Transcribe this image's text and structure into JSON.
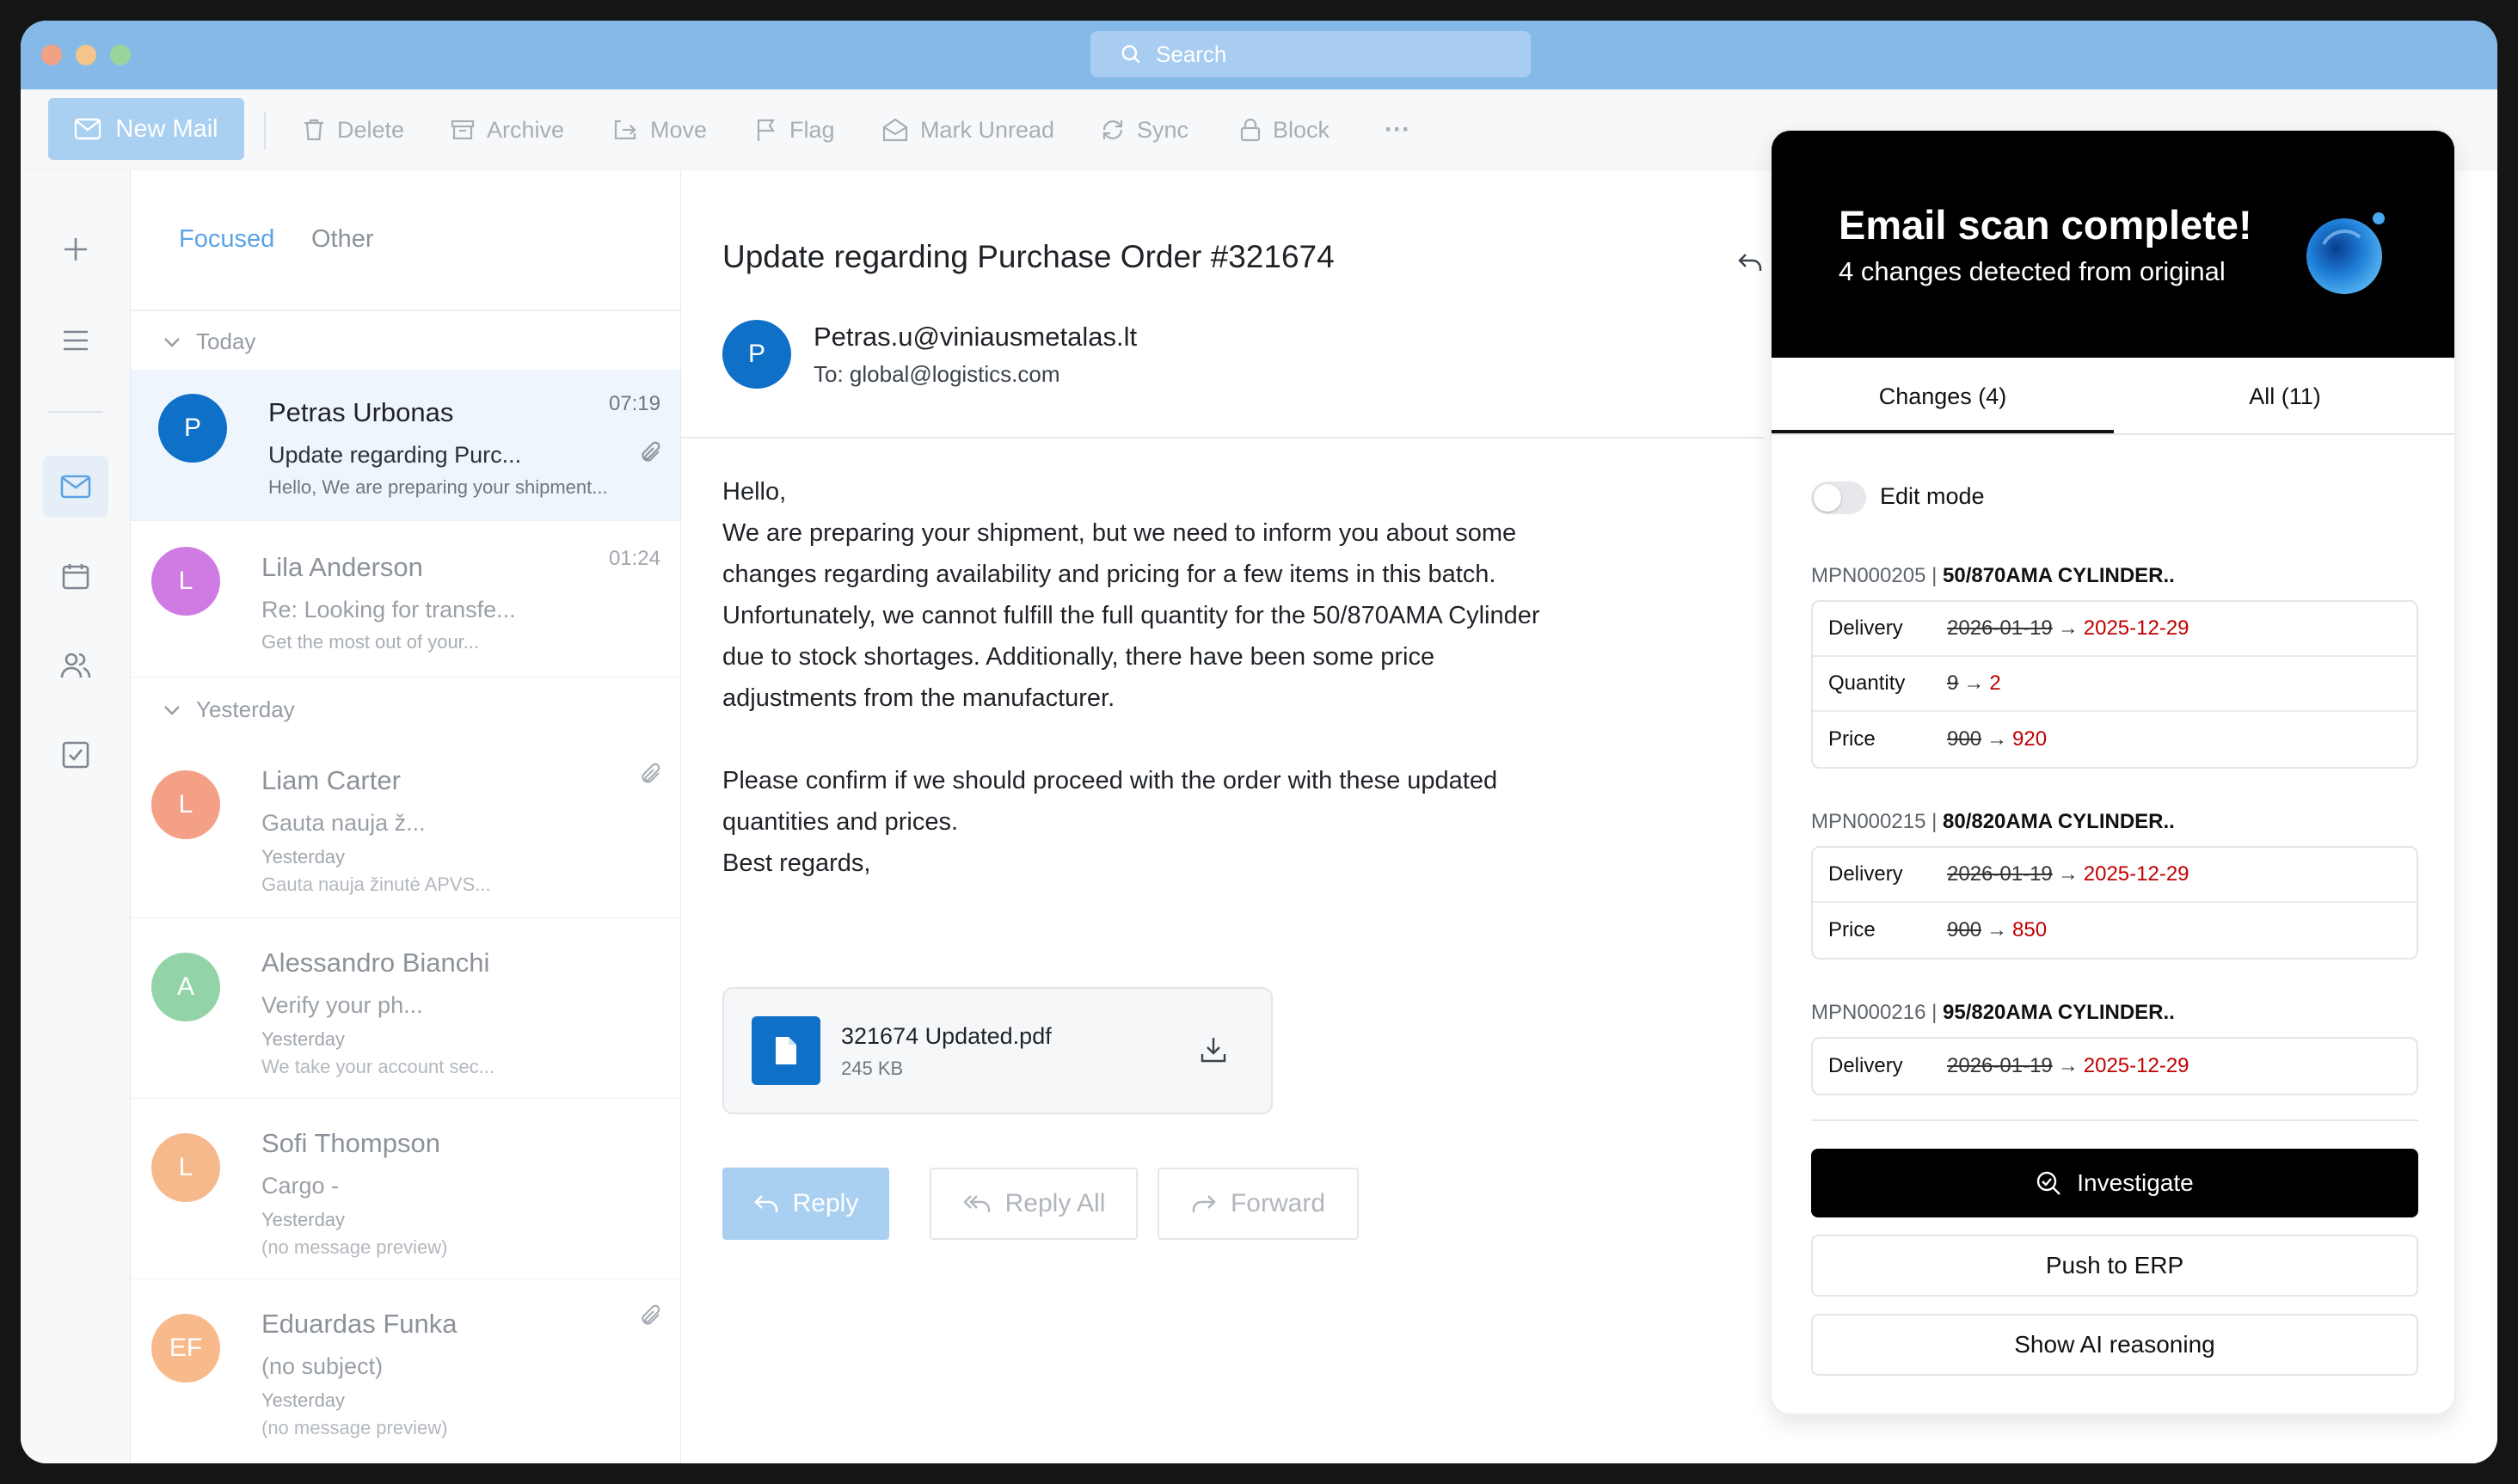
{
  "search": {
    "placeholder": "Search"
  },
  "toolbar": {
    "new_mail": "New Mail",
    "delete": "Delete",
    "archive": "Archive",
    "move": "Move",
    "flag": "Flag",
    "mark_unread": "Mark Unread",
    "sync": "Sync",
    "block": "Block",
    "more": "···"
  },
  "list": {
    "tabs": {
      "focused": "Focused",
      "other": "Other"
    },
    "groups": {
      "today": "Today",
      "yesterday": "Yesterday"
    },
    "items": [
      {
        "initials": "P",
        "name": "Petras Urbonas",
        "subject": "Update regarding Purc...",
        "preview": "Hello, We are preparing your shipment...",
        "time": "07:19",
        "color": "#0f70c8"
      },
      {
        "initials": "L",
        "name": "Lila Anderson",
        "subject": "Re: Looking for transfe...",
        "preview": "Get the most out of your...",
        "time": "01:24",
        "color": "#d07be4"
      },
      {
        "initials": "L",
        "name": "Liam Carter",
        "subject": "Gauta nauja ž...",
        "day": "Yesterday",
        "preview": "Gauta nauja žinutė APVS...",
        "color": "#f3a087"
      },
      {
        "initials": "A",
        "name": "Alessandro Bianchi",
        "subject": "Verify your ph...",
        "day": "Yesterday",
        "preview": "We take your account sec...",
        "color": "#93d3a8"
      },
      {
        "initials": "L",
        "name": "Sofi Thompson",
        "subject": "Cargo -",
        "day": "Yesterday",
        "preview": "(no message preview)",
        "color": "#f6b98c"
      },
      {
        "initials": "EF",
        "name": "Eduardas Funka",
        "subject": "(no subject)",
        "day": "Yesterday",
        "preview": "(no message preview)",
        "color": "#f8b98b"
      }
    ]
  },
  "message": {
    "subject": "Update regarding Purchase Order #321674",
    "avatar": "P",
    "from": "Petras.u@viniausmetalas.lt",
    "to_label": "To:",
    "to": "global@logistics.com",
    "body": [
      "Hello,",
      "We are preparing your shipment, but we need to inform you about some",
      "changes regarding availability and pricing for a few items in this batch.",
      "Unfortunately, we cannot fulfill the full quantity for the 50/870AMA Cylinder",
      "due to stock shortages. Additionally, there have been some price",
      "adjustments from the manufacturer.",
      "",
      "Please confirm if we should proceed with the order with these updated",
      "quantities and prices.",
      "Best regards,"
    ],
    "attachment": {
      "name": "321674 Updated.pdf",
      "size": "245 KB"
    },
    "actions": {
      "reply": "Reply",
      "reply_all": "Reply All",
      "forward": "Forward"
    }
  },
  "panel": {
    "title": "Email scan complete!",
    "subtitle": "4 changes detected from original",
    "tabs": {
      "changes": "Changes (4)",
      "all": "All (11)"
    },
    "edit_mode": "Edit mode",
    "arrow": "→",
    "sections": [
      {
        "code": "MPN000205",
        "sep": "|",
        "name": "50/870AMA CYLINDER..",
        "rows": [
          {
            "label": "Delivery",
            "old": "2026-01-19",
            "new": "2025-12-29"
          },
          {
            "label": "Quantity",
            "old": "9",
            "new": "2"
          },
          {
            "label": "Price",
            "old": "900",
            "new": "920"
          }
        ]
      },
      {
        "code": "MPN000215",
        "sep": "|",
        "name": "80/820AMA CYLINDER..",
        "rows": [
          {
            "label": "Delivery",
            "old": "2026-01-19",
            "new": "2025-12-29"
          },
          {
            "label": "Price",
            "old": "900",
            "new": "850"
          }
        ]
      },
      {
        "code": "MPN000216",
        "sep": "|",
        "name": "95/820AMA CYLINDER..",
        "rows": [
          {
            "label": "Delivery",
            "old": "2026-01-19",
            "new": "2025-12-29"
          }
        ]
      }
    ],
    "buttons": {
      "investigate": "Investigate",
      "erp": "Push to ERP",
      "reasoning": "Show AI reasoning"
    }
  },
  "colors": {
    "titlebar": "#85b9e8",
    "accent": "#0f70c8",
    "change_new": "#c00000"
  }
}
